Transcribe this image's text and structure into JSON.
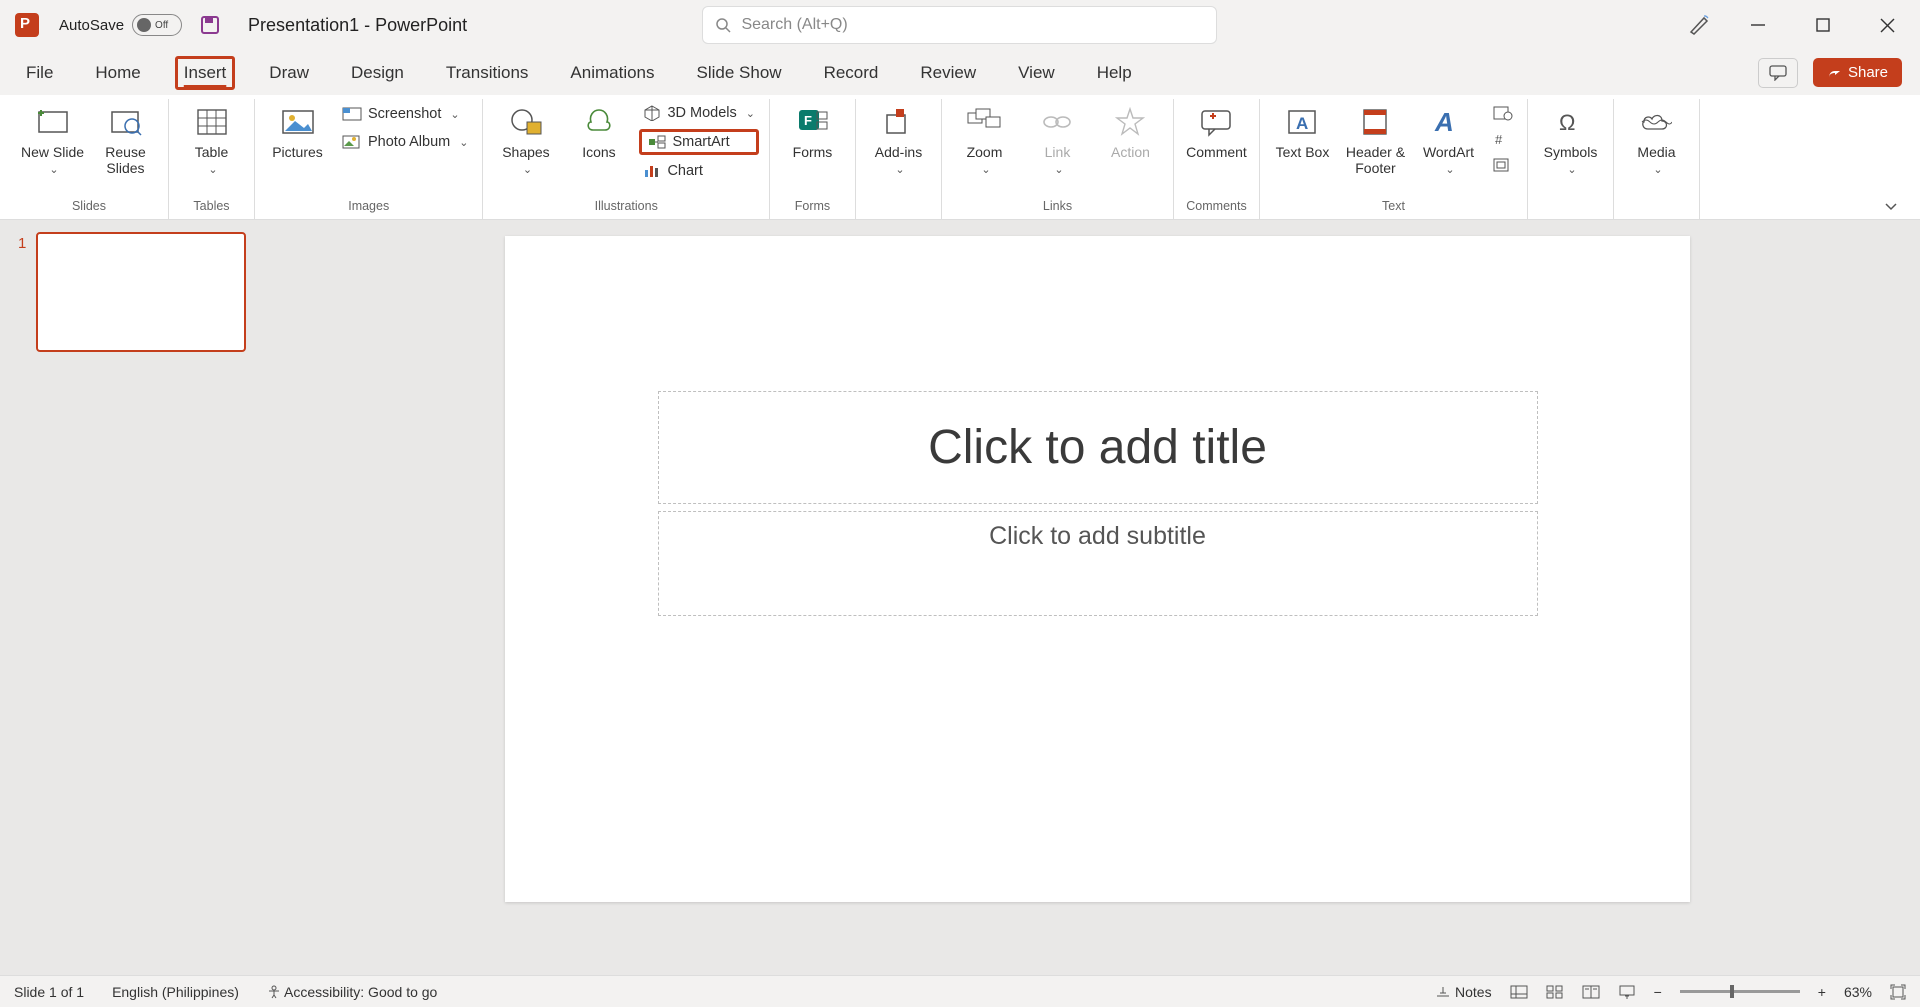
{
  "titlebar": {
    "autosave_label": "AutoSave",
    "autosave_state": "Off",
    "document_title": "Presentation1  -  PowerPoint",
    "search_placeholder": "Search (Alt+Q)"
  },
  "tabs": {
    "items": [
      "File",
      "Home",
      "Insert",
      "Draw",
      "Design",
      "Transitions",
      "Animations",
      "Slide Show",
      "Record",
      "Review",
      "View",
      "Help"
    ],
    "active": "Insert",
    "share_label": "Share"
  },
  "ribbon": {
    "groups": [
      {
        "label": "Slides",
        "items": [
          {
            "name": "new-slide",
            "label": "New Slide",
            "drop": true
          },
          {
            "name": "reuse-slides",
            "label": "Reuse Slides"
          }
        ]
      },
      {
        "label": "Tables",
        "items": [
          {
            "name": "table",
            "label": "Table",
            "drop": true
          }
        ]
      },
      {
        "label": "Images",
        "items": [
          {
            "name": "pictures",
            "label": "Pictures"
          }
        ],
        "small": [
          {
            "name": "screenshot",
            "label": "Screenshot",
            "drop": true
          },
          {
            "name": "photo-album",
            "label": "Photo Album",
            "drop": true
          }
        ]
      },
      {
        "label": "Illustrations",
        "items": [
          {
            "name": "shapes",
            "label": "Shapes",
            "drop": true
          },
          {
            "name": "icons",
            "label": "Icons"
          }
        ],
        "small": [
          {
            "name": "3d-models",
            "label": "3D Models",
            "drop": true
          },
          {
            "name": "smartart",
            "label": "SmartArt",
            "highlighted": true
          },
          {
            "name": "chart",
            "label": "Chart"
          }
        ]
      },
      {
        "label": "Forms",
        "items": [
          {
            "name": "forms",
            "label": "Forms"
          }
        ]
      },
      {
        "label": "",
        "items": [
          {
            "name": "addins",
            "label": "Add-ins",
            "drop": true
          }
        ]
      },
      {
        "label": "Links",
        "items": [
          {
            "name": "zoom",
            "label": "Zoom",
            "drop": true
          },
          {
            "name": "link",
            "label": "Link",
            "drop": true,
            "disabled": true
          },
          {
            "name": "action",
            "label": "Action",
            "disabled": true
          }
        ]
      },
      {
        "label": "Comments",
        "items": [
          {
            "name": "comment",
            "label": "Comment"
          }
        ]
      },
      {
        "label": "Text",
        "items": [
          {
            "name": "text-box",
            "label": "Text Box"
          },
          {
            "name": "header-footer",
            "label": "Header & Footer"
          },
          {
            "name": "wordart",
            "label": "WordArt",
            "drop": true
          }
        ],
        "small_icons": [
          "date-time",
          "slide-number",
          "object"
        ]
      },
      {
        "label": "",
        "items": [
          {
            "name": "symbols",
            "label": "Symbols",
            "drop": true
          }
        ]
      },
      {
        "label": "",
        "items": [
          {
            "name": "media",
            "label": "Media",
            "drop": true
          }
        ]
      }
    ]
  },
  "slide": {
    "number": "1",
    "title_placeholder": "Click to add title",
    "subtitle_placeholder": "Click to add subtitle"
  },
  "statusbar": {
    "slide_indicator": "Slide 1 of 1",
    "language": "English (Philippines)",
    "accessibility": "Accessibility: Good to go",
    "notes_label": "Notes",
    "zoom_percent": "63%"
  }
}
